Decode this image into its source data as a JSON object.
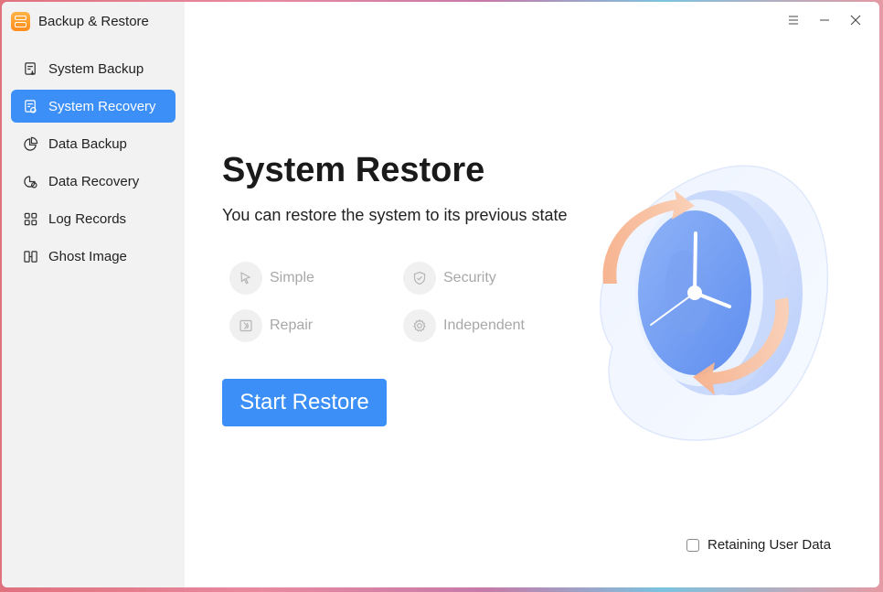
{
  "app": {
    "title": "Backup & Restore"
  },
  "sidebar": {
    "items": [
      {
        "label": "System Backup",
        "icon": "system-backup-icon",
        "active": false
      },
      {
        "label": "System Recovery",
        "icon": "system-recovery-icon",
        "active": true
      },
      {
        "label": "Data Backup",
        "icon": "pie-chart-icon",
        "active": false
      },
      {
        "label": "Data Recovery",
        "icon": "data-recovery-icon",
        "active": false
      },
      {
        "label": "Log Records",
        "icon": "grid-icon",
        "active": false
      },
      {
        "label": "Ghost Image",
        "icon": "ghost-image-icon",
        "active": false
      }
    ]
  },
  "titlebar": {
    "menu_icon": "hamburger-menu-icon",
    "minimize_icon": "minimize-icon",
    "close_icon": "close-icon"
  },
  "main": {
    "title": "System Restore",
    "subtitle": "You can restore the system to its previous state",
    "features": [
      {
        "label": "Simple",
        "icon": "cursor-icon"
      },
      {
        "label": "Security",
        "icon": "shield-icon"
      },
      {
        "label": "Repair",
        "icon": "repair-icon"
      },
      {
        "label": "Independent",
        "icon": "gear-icon"
      }
    ],
    "start_button": "Start Restore",
    "retain_label": "Retaining User Data",
    "retain_checked": false
  },
  "colors": {
    "accent": "#3b8ff6",
    "sidebar_bg": "#f2f2f2",
    "feature_text": "#a8a8a8"
  }
}
